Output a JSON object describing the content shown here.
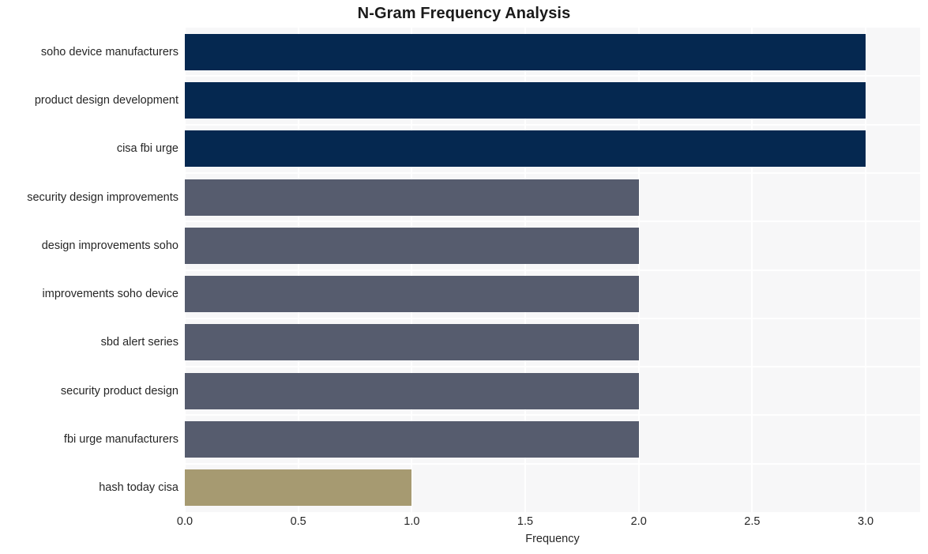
{
  "chart_data": {
    "type": "bar",
    "orientation": "horizontal",
    "title": "N-Gram Frequency Analysis",
    "xlabel": "Frequency",
    "ylabel": "",
    "categories": [
      "soho device manufacturers",
      "product design development",
      "cisa fbi urge",
      "security design improvements",
      "design improvements soho",
      "improvements soho device",
      "sbd alert series",
      "security product design",
      "fbi urge manufacturers",
      "hash today cisa"
    ],
    "values": [
      3,
      3,
      3,
      2,
      2,
      2,
      2,
      2,
      2,
      1
    ],
    "bar_colors": [
      "#052850",
      "#052850",
      "#052850",
      "#565c6e",
      "#565c6e",
      "#565c6e",
      "#565c6e",
      "#565c6e",
      "#565c6e",
      "#a69a71"
    ],
    "xlim": [
      0,
      3.24
    ],
    "x_ticks": [
      0,
      0.5,
      1,
      1.5,
      2,
      2.5,
      3
    ],
    "x_tick_labels": [
      "0.0",
      "0.5",
      "1.0",
      "1.5",
      "2.0",
      "2.5",
      "3.0"
    ],
    "grid": true,
    "grid_color": "#ffffff",
    "plot_background": "#f7f7f8",
    "figure_background": "#ffffff",
    "legend": null,
    "title_color": "#1a1a1a",
    "tick_label_color": "#262626"
  }
}
